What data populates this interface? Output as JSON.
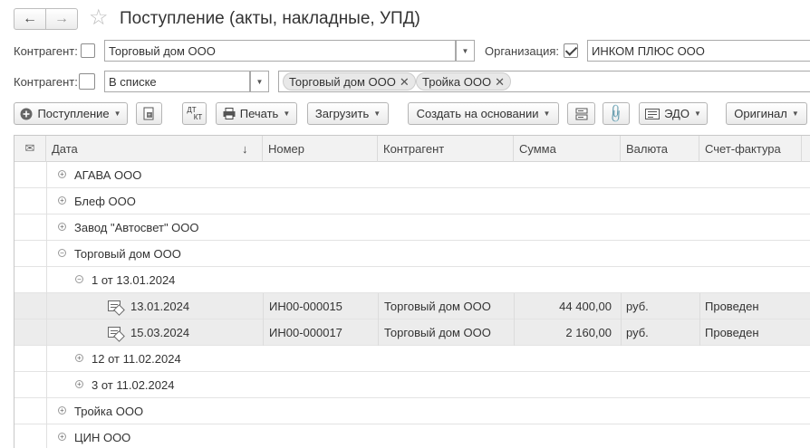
{
  "header": {
    "back_icon": "arrow-left-icon",
    "forward_icon": "arrow-right-icon",
    "star_icon": "star-icon",
    "title": "Поступление (акты, накладные, УПД)"
  },
  "filters": {
    "row1": {
      "kontragent_label": "Контрагент:",
      "kontragent_value": "Торговый дом ООО",
      "org_label": "Организация:",
      "org_value": "ИНКОМ ПЛЮС ООО"
    },
    "row2": {
      "kontragent_label": "Контрагент:",
      "mode_value": "В списке",
      "tags": [
        "Торговый дом ООО",
        "Тройка ООО"
      ]
    }
  },
  "toolbar": {
    "postuplenie": "Поступление",
    "dt_kt_top": "ДТ",
    "dt_kt_bottom": "КТ",
    "print": "Печать",
    "load": "Загрузить",
    "create_based": "Создать на основании",
    "edo": "ЭДО",
    "original": "Оригинал"
  },
  "table": {
    "columns": [
      "Дата",
      "Номер",
      "Контрагент",
      "Сумма",
      "Валюта",
      "Счет-фактура"
    ],
    "sort_indicator": "↓",
    "rows": [
      {
        "level": 0,
        "toggle": "⊕",
        "label": "АГАВА  ООО"
      },
      {
        "level": 0,
        "toggle": "⊕",
        "label": "Блеф ООО"
      },
      {
        "level": 0,
        "toggle": "⊕",
        "label": "Завод \"Автосвет\" ООО"
      },
      {
        "level": 0,
        "toggle": "⊖",
        "label": "Торговый дом ООО"
      },
      {
        "level": 1,
        "toggle": "⊖",
        "label": "1 от 13.01.2024"
      },
      {
        "level": 2,
        "date": "13.01.2024",
        "number": "ИН00-000015",
        "kontragent": "Торговый дом ООО",
        "sum": "44 400,00",
        "currency": "руб.",
        "invoice": "Проведен"
      },
      {
        "level": 2,
        "date": "15.03.2024",
        "number": "ИН00-000017",
        "kontragent": "Торговый дом ООО",
        "sum": "2 160,00",
        "currency": "руб.",
        "invoice": "Проведен"
      },
      {
        "level": 1,
        "toggle": "⊕",
        "label": "12 от 11.02.2024"
      },
      {
        "level": 1,
        "toggle": "⊕",
        "label": "3 от 11.02.2024"
      },
      {
        "level": 0,
        "toggle": "⊕",
        "label": "Тройка ООО"
      },
      {
        "level": 0,
        "toggle": "⊕",
        "label": "ЦИН ООО"
      }
    ]
  }
}
